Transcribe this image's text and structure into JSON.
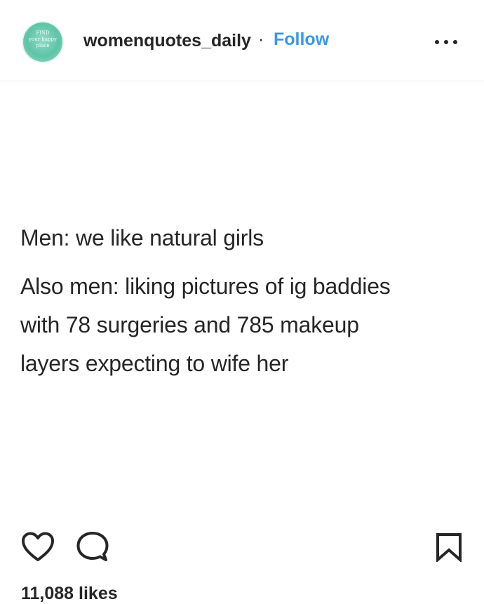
{
  "header": {
    "avatar_text": "FIND\nyour happy\nplace",
    "username": "womenquotes_daily",
    "separator": "·",
    "follow_label": "Follow",
    "more_icon": "more-horizontal-icon"
  },
  "post": {
    "lines": [
      "Men: we like natural girls",
      "Also men: liking pictures of ig baddies",
      "with 78 surgeries and 785 makeup",
      "layers expecting to wife her"
    ]
  },
  "actions": {
    "like_icon": "heart-icon",
    "comment_icon": "comment-icon",
    "save_icon": "bookmark-icon"
  },
  "likes": "11,088 likes",
  "colors": {
    "follow": "#3897f0",
    "text": "#262626",
    "avatar": "#5ec4a7"
  }
}
